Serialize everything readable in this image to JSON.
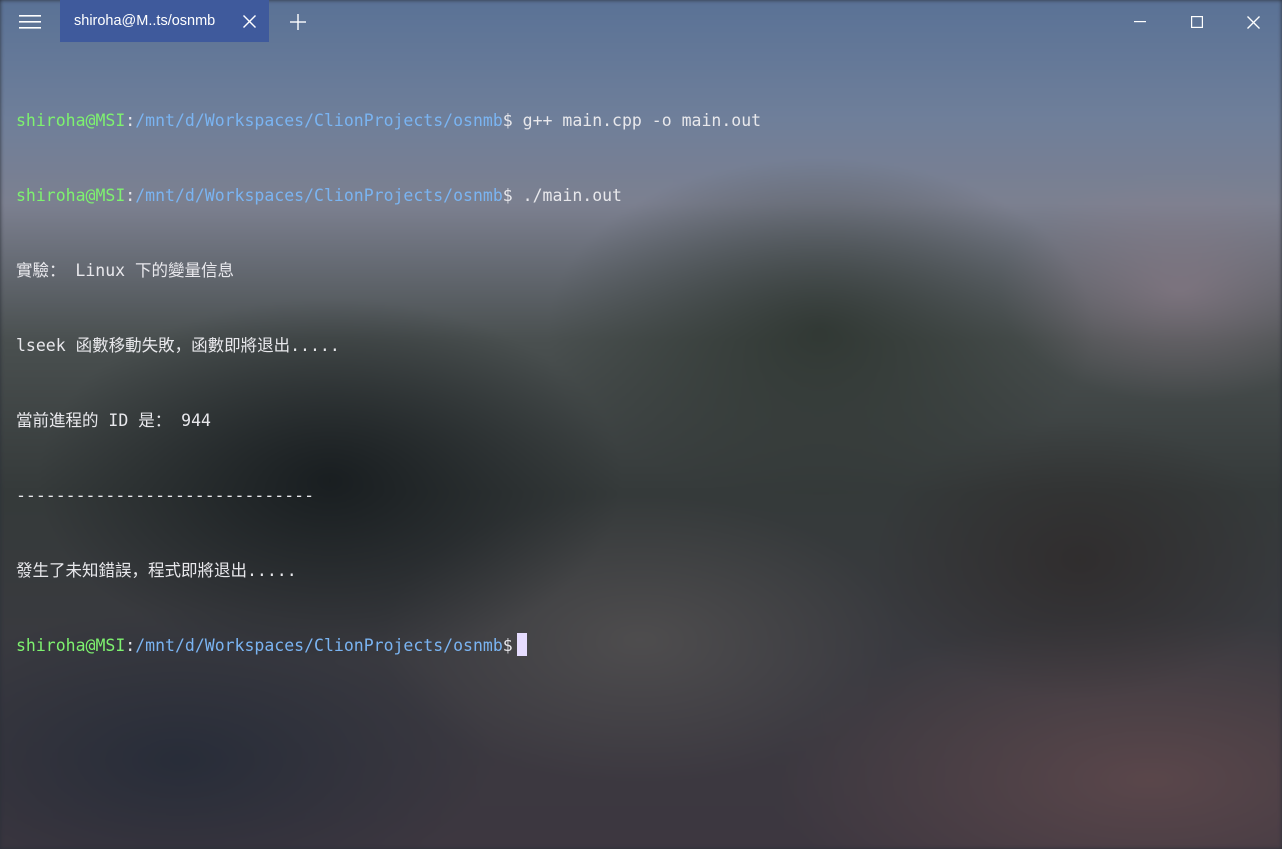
{
  "window": {
    "tab_title": "shiroha@M..ts/osnmb",
    "menu_icon": "hamburger-icon",
    "close_tab_icon": "close-icon",
    "new_tab_icon": "plus-icon",
    "minimize_icon": "minimize-icon",
    "maximize_icon": "maximize-icon",
    "close_window_icon": "close-icon",
    "tab_color": "#3f5a9c"
  },
  "terminal": {
    "prompt": {
      "user_host": "shiroha@MSI",
      "colon": ":",
      "path": "/mnt/d/Workspaces/ClionProjects/osnmb",
      "symbol": "$"
    },
    "colors": {
      "user_host": "#7ef26f",
      "path": "#7ab4f2",
      "text": "#e8e8ec",
      "cursor": "#e6dcff"
    },
    "cmd1": " g++ main.cpp -o main.out",
    "cmd2": " ./main.out",
    "out1": "實驗： Linux 下的變量信息",
    "out2": "lseek 函數移動失敗，函數即將退出.....",
    "out3": "當前進程的 ID 是： 944",
    "out4": "------------------------------",
    "out5": "發生了未知錯誤，程式即將退出....."
  }
}
